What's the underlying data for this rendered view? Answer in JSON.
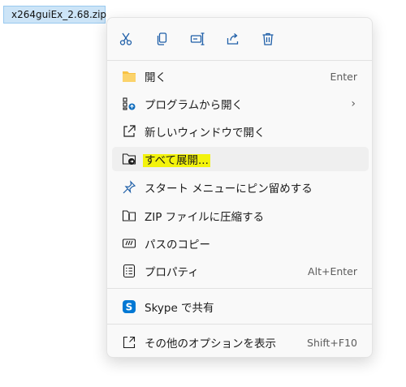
{
  "file": {
    "name": "x264guiEx_2.68.zip"
  },
  "toolbar": {
    "cut": "cut-icon",
    "copy": "copy-icon",
    "rename": "rename-icon",
    "share": "share-icon",
    "delete": "delete-icon"
  },
  "menu": {
    "open": {
      "label": "開く",
      "shortcut": "Enter"
    },
    "open_with": {
      "label": "プログラムから開く",
      "chevron": "›"
    },
    "open_new_window": {
      "label": "新しいウィンドウで開く"
    },
    "extract_all": {
      "label": "すべて展開..."
    },
    "pin_start": {
      "label": "スタート メニューにピン留めする"
    },
    "compress_zip": {
      "label": "ZIP ファイルに圧縮する"
    },
    "copy_path": {
      "label": "パスのコピー"
    },
    "properties": {
      "label": "プロパティ",
      "shortcut": "Alt+Enter"
    },
    "skype_share": {
      "label": "Skype で共有"
    },
    "more_options": {
      "label": "その他のオプションを表示",
      "shortcut": "Shift+F10"
    }
  },
  "colors": {
    "accent": "#0f6cbd",
    "highlight": "#f3f30c",
    "folder": "#f7c244"
  }
}
